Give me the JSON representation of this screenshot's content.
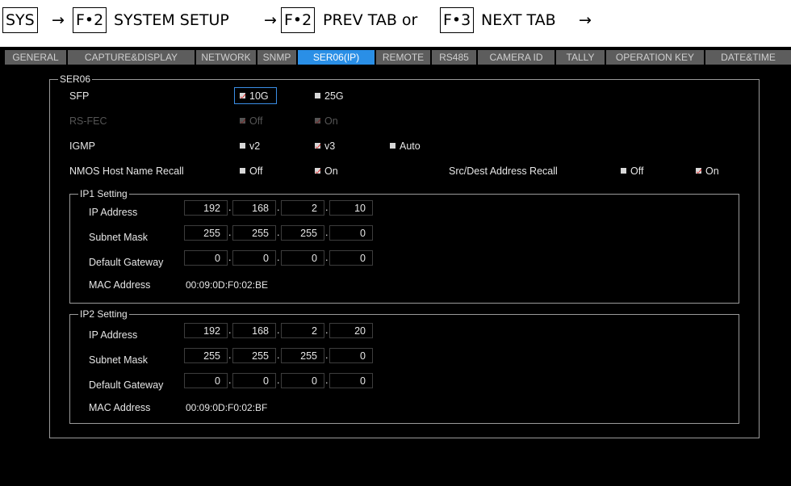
{
  "breadcrumb": {
    "sys": "SYS",
    "arrow": "→",
    "f2_key": "F•2",
    "system_setup": "SYSTEM SETUP",
    "f2_key_2": "F•2",
    "prev_tab": "PREV TAB or",
    "f3_key": "F•3",
    "next_tab": "NEXT TAB",
    "arrow_end": "→"
  },
  "tabs": [
    "GENERAL",
    "CAPTURE&DISPLAY",
    "NETWORK",
    "SNMP",
    "SER06(IP)",
    "REMOTE",
    "RS485",
    "CAMERA ID",
    "TALLY",
    "OPERATION KEY",
    "DATE&TIME"
  ],
  "active_tab": "SER06(IP)",
  "section": {
    "legend": "SER06",
    "sfp": {
      "label": "SFP",
      "options": [
        "10G",
        "25G"
      ],
      "selected": "10G"
    },
    "rs_fec": {
      "label": "RS-FEC",
      "options": [
        "Off",
        "On"
      ],
      "selected": "On",
      "disabled": true
    },
    "igmp": {
      "label": "IGMP",
      "options": [
        "v2",
        "v3",
        "Auto"
      ],
      "selected": "v3"
    },
    "nmos": {
      "label": "NMOS Host Name Recall",
      "options": [
        "Off",
        "On"
      ],
      "selected": "On"
    },
    "srcdest": {
      "label": "Src/Dest Address Recall",
      "options": [
        "Off",
        "On"
      ],
      "selected": "On"
    },
    "ip1": {
      "legend": "IP1 Setting",
      "ip_label": "IP Address",
      "ip": [
        "192",
        "168",
        "2",
        "10"
      ],
      "subnet_label": "Subnet Mask",
      "subnet": [
        "255",
        "255",
        "255",
        "0"
      ],
      "gateway_label": "Default Gateway",
      "gateway": [
        "0",
        "0",
        "0",
        "0"
      ],
      "mac_label": "MAC Address",
      "mac": "00:09:0D:F0:02:BE"
    },
    "ip2": {
      "legend": "IP2 Setting",
      "ip_label": "IP Address",
      "ip": [
        "192",
        "168",
        "2",
        "20"
      ],
      "subnet_label": "Subnet Mask",
      "subnet": [
        "255",
        "255",
        "255",
        "0"
      ],
      "gateway_label": "Default Gateway",
      "gateway": [
        "0",
        "0",
        "0",
        "0"
      ],
      "mac_label": "MAC Address",
      "mac": "00:09:0D:F0:02:BF"
    }
  },
  "colors": {
    "accent": "#2a8fe6",
    "check": "#e02020",
    "tab_bg": "#5d5d5d"
  }
}
